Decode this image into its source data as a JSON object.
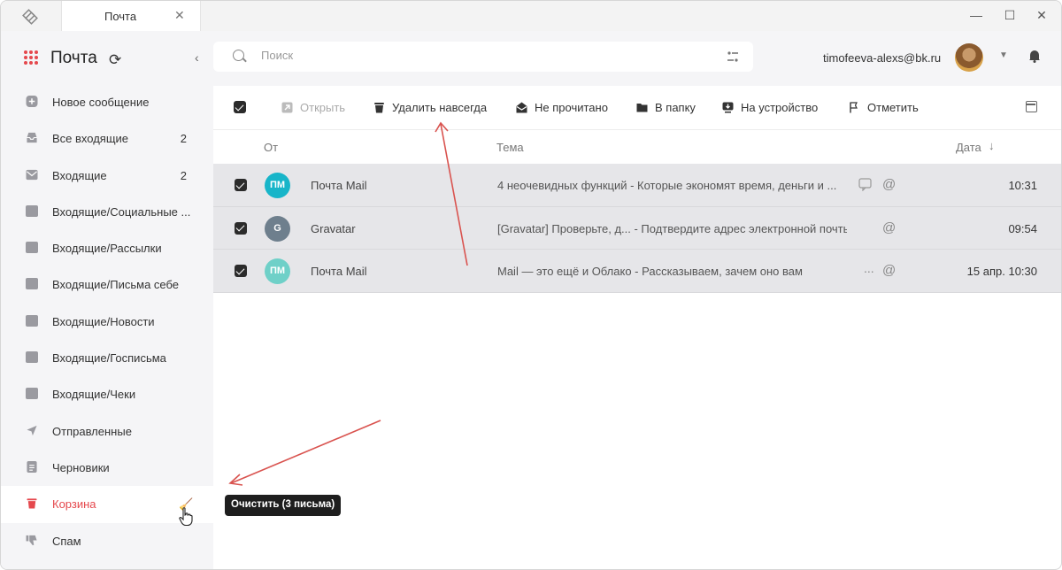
{
  "window": {
    "tab_title": "Почта",
    "tab_close_icon": "close-icon",
    "controls": [
      "minimize-icon",
      "maximize-icon",
      "close-icon"
    ]
  },
  "sidebar": {
    "brand_title": "Почта",
    "items": [
      {
        "label": "Новое сообщение",
        "icon": "plus-icon"
      },
      {
        "label": "Все входящие",
        "count": "2",
        "icon": "inbox-icon"
      },
      {
        "label": "Входящие",
        "count": "2",
        "icon": "envelope-icon"
      },
      {
        "label": "Входящие/Социальные ...",
        "icon": "folder-icon"
      },
      {
        "label": "Входящие/Рассылки",
        "icon": "folder-icon"
      },
      {
        "label": "Входящие/Письма себе",
        "icon": "folder-icon"
      },
      {
        "label": "Входящие/Новости",
        "icon": "folder-icon"
      },
      {
        "label": "Входящие/Госписьма",
        "icon": "folder-icon"
      },
      {
        "label": "Входящие/Чеки",
        "icon": "folder-icon"
      },
      {
        "label": "Отправленные",
        "icon": "send-icon"
      },
      {
        "label": "Черновики",
        "icon": "draft-icon"
      },
      {
        "label": "Корзина",
        "icon": "trash-icon",
        "active": true
      },
      {
        "label": "Спам",
        "icon": "thumbs-down-icon"
      }
    ]
  },
  "search": {
    "placeholder": "Поиск"
  },
  "user": {
    "email": "timofeeva-alexs@bk.ru"
  },
  "toolbar": {
    "open": "Открыть",
    "delete_forever": "Удалить навсегда",
    "unread": "Не прочитано",
    "to_folder": "В папку",
    "to_device": "На устройство",
    "mark": "Отметить"
  },
  "columns": {
    "from": "От",
    "subject": "Тема",
    "date": "Дата"
  },
  "messages": [
    {
      "initials": "ПМ",
      "avatar_color": "#18b5c9",
      "sender": "Почта Mail",
      "subject": "4 неочевидных функций - Которые экономят время, деньги и ...",
      "date": "10:31"
    },
    {
      "initials": "G",
      "avatar_color": "#6e7f8d",
      "sender": "Gravatar",
      "subject": "[Gravatar] Проверьте, д...  - Подтвердите адрес электронной почты...",
      "date": "09:54"
    },
    {
      "initials": "ПМ",
      "avatar_color": "#6fd0c8",
      "sender": "Почта Mail",
      "subject": "Mail — это ещё и Облако - Рассказываем, зачем оно вам",
      "date": "15 апр. 10:30"
    }
  ],
  "tooltip": {
    "text": "Очистить (3 письма)"
  },
  "colors": {
    "accent": "#e5484d",
    "annotation": "#d9534f",
    "row_selected": "#e6e6e9"
  }
}
